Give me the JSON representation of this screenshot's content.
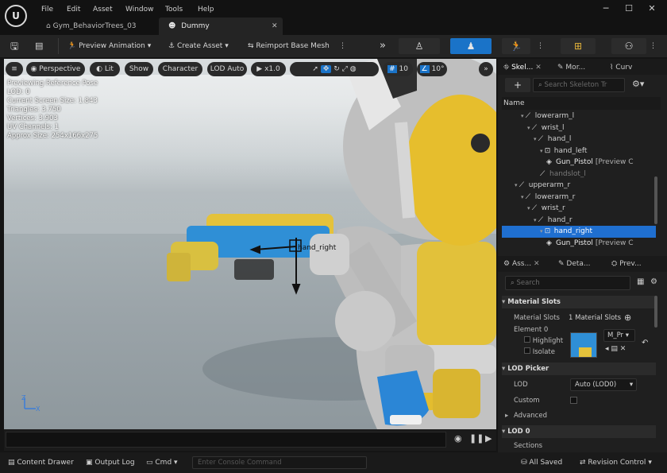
{
  "menu": [
    "File",
    "Edit",
    "Asset",
    "Window",
    "Tools",
    "Help"
  ],
  "window_controls": [
    "─",
    "☐",
    "✕"
  ],
  "tabs": [
    {
      "label": "Gym_BehaviorTrees_03"
    },
    {
      "label": "Dummy"
    }
  ],
  "toolbar": {
    "preview_animation": "Preview Animation",
    "create_asset": "Create Asset",
    "reimport": "Reimport Base Mesh",
    "more": "»"
  },
  "viewport": {
    "perspective": "Perspective",
    "lit": "Lit",
    "show": "Show",
    "character": "Character",
    "lod": "LOD Auto",
    "speed": "x1.0",
    "grid_value": "10",
    "angle_value": "10°",
    "stats": [
      "Previewing Reference Pose",
      "LOD: 0",
      "Current Screen Size: 1.843",
      "Triangles: 3.750",
      "Vertices: 3.903",
      "UV Channels: 1",
      "Approx Size: 254x166x275"
    ],
    "socket_label": "hand_right",
    "axis_labels": {
      "z": "Z",
      "x": "X"
    }
  },
  "skeleton_panel": {
    "tabs": [
      "Skel...",
      "Mor...",
      "Curv"
    ],
    "search_placeholder": "Search Skeleton Tr",
    "column_header": "Name",
    "tree": [
      {
        "label": "lowerarm_l",
        "indent": 3,
        "kind": "bone"
      },
      {
        "label": "wrist_l",
        "indent": 4,
        "kind": "bone"
      },
      {
        "label": "hand_l",
        "indent": 5,
        "kind": "bone"
      },
      {
        "label": "hand_left",
        "indent": 6,
        "kind": "socket"
      },
      {
        "label": "Gun_Pistol",
        "suffix": "[Preview C",
        "indent": 7,
        "kind": "mesh"
      },
      {
        "label": "handslot_l",
        "indent": 6,
        "kind": "bone_dim"
      },
      {
        "label": "upperarm_r",
        "indent": 2,
        "kind": "bone"
      },
      {
        "label": "lowerarm_r",
        "indent": 3,
        "kind": "bone"
      },
      {
        "label": "wrist_r",
        "indent": 4,
        "kind": "bone"
      },
      {
        "label": "hand_r",
        "indent": 5,
        "kind": "bone"
      },
      {
        "label": "hand_right",
        "indent": 6,
        "kind": "socket",
        "selected": true
      },
      {
        "label": "Gun_Pistol",
        "suffix": "[Preview C",
        "indent": 7,
        "kind": "mesh"
      }
    ]
  },
  "details_panel": {
    "tabs": [
      "Ass...",
      "Deta...",
      "Prev..."
    ],
    "search_placeholder": "Search",
    "material_slots_header": "Material Slots",
    "material_slots_label": "Material Slots",
    "material_slots_value": "1 Material Slots",
    "element0": "Element 0",
    "highlight": "Highlight",
    "isolate": "Isolate",
    "material_name": "M_Pr",
    "lod_picker_header": "LOD Picker",
    "lod_label": "LOD",
    "lod_value": "Auto (LOD0)",
    "custom_label": "Custom",
    "advanced_label": "Advanced",
    "lod0_header": "LOD 0",
    "sections_label": "Sections"
  },
  "statusbar": {
    "content_drawer": "Content Drawer",
    "output_log": "Output Log",
    "cmd": "Cmd",
    "console_placeholder": "Enter Console Command",
    "all_saved": "All Saved",
    "revision_control": "Revision Control"
  },
  "colors": {
    "accent_blue": "#1a73c8",
    "character_yellow": "#e9c12d",
    "gun_blue": "#2f8fd6",
    "selected_row": "#1f6fd0"
  }
}
